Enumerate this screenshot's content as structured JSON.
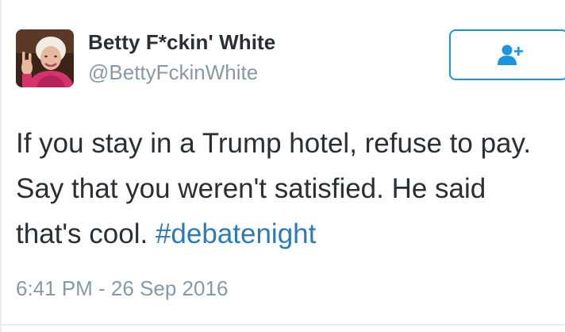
{
  "tweet": {
    "author": {
      "display_name": "Betty F*ckin' White",
      "handle": "@BettyFckinWhite",
      "avatar_icon": "profile-photo"
    },
    "follow_button": {
      "icon": "add-user-icon",
      "accent_color": "#1b95e0"
    },
    "text": {
      "line1": "If you stay in a Trump hotel, refuse to pay.",
      "line2": "Say that you weren't satisfied. He said",
      "line3_prefix": "that's cool. ",
      "hashtag": "#debatenight"
    },
    "timestamp": "6:41 PM - 26 Sep 2016"
  },
  "colors": {
    "text": "#292f33",
    "secondary": "#8899a6",
    "link": "#2b7bb9",
    "divider": "#e6ecf0"
  }
}
